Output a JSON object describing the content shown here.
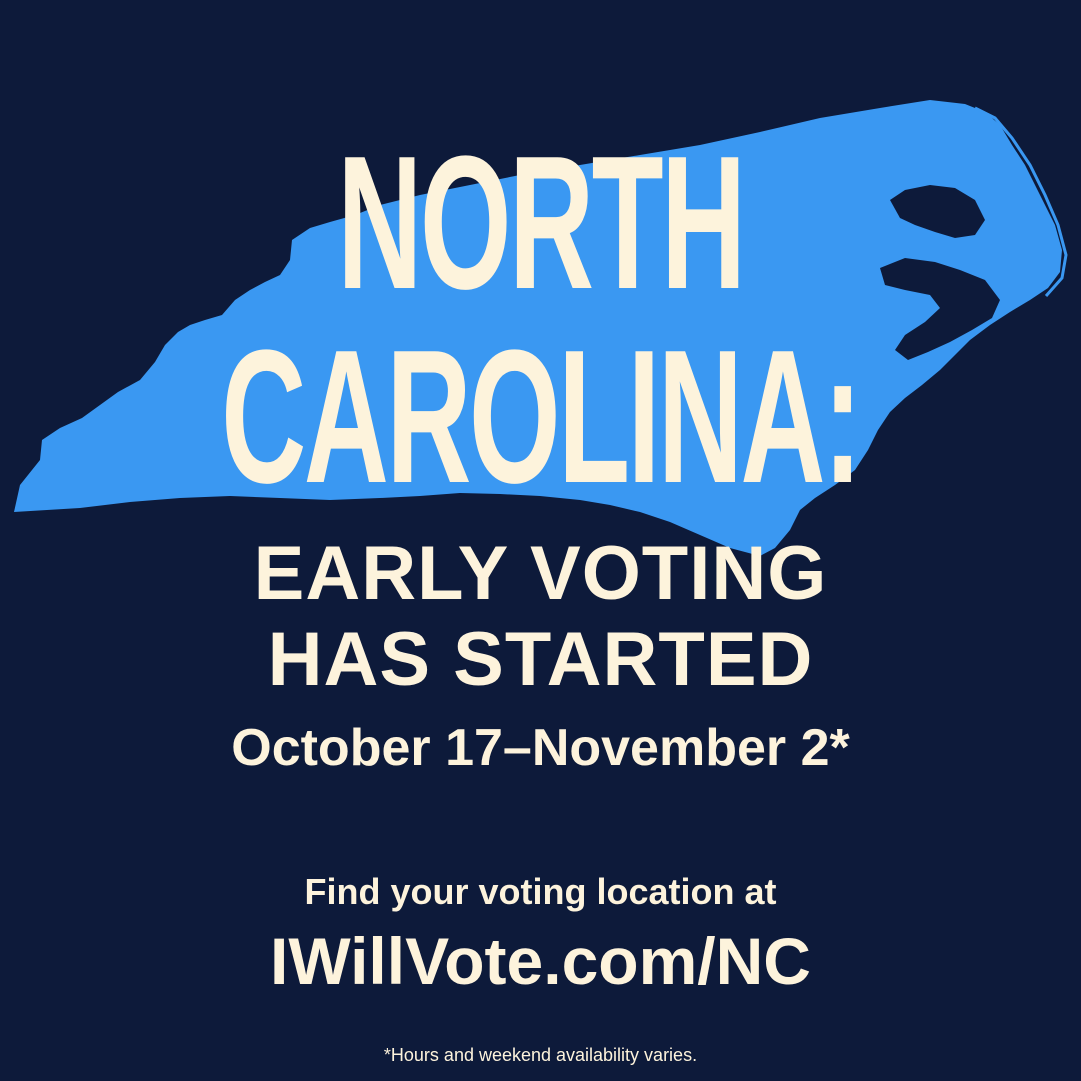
{
  "poster": {
    "headline_line_1": "NORTH",
    "headline_line_2": "CAROLINA:",
    "subhead_line_1": "EARLY VOTING",
    "subhead_line_2": "HAS STARTED",
    "dates": "October 17–November 2*",
    "find_text": "Find your voting location at",
    "url": "IWillVote.com/NC",
    "footnote": "*Hours and weekend availability varies."
  },
  "colors": {
    "background": "#0d1a3a",
    "state_fill": "#3a98f2",
    "text": "#fdf3dc"
  },
  "graphics": {
    "map_icon": "north-carolina-state-silhouette"
  }
}
